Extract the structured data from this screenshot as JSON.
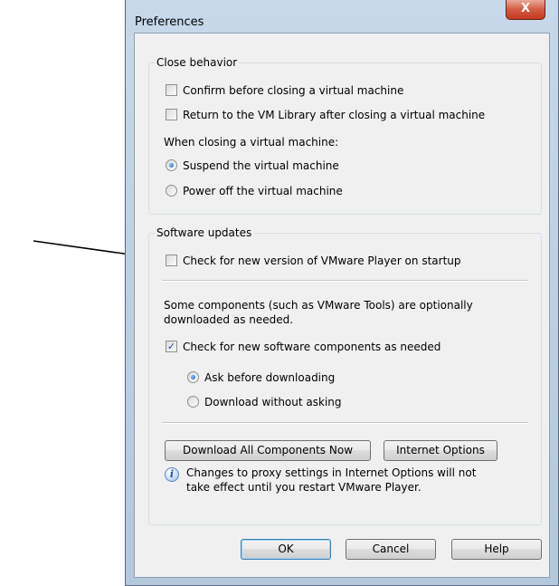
{
  "window": {
    "title": "Preferences",
    "close_glyph": "X"
  },
  "close_behavior": {
    "title": "Close behavior",
    "confirm_label": "Confirm before closing a virtual machine",
    "confirm_checked": false,
    "return_label": "Return to the VM Library after closing a virtual machine",
    "return_checked": false,
    "when_closing_label": "When closing a virtual machine:",
    "suspend_label": "Suspend the virtual machine",
    "power_off_label": "Power off the virtual machine",
    "selected_option": "suspend"
  },
  "software_updates": {
    "title": "Software updates",
    "check_new_version_label": "Check for new version of VMware Player on startup",
    "check_new_version_checked": false,
    "components_note_line1": "Some components (such as VMware Tools) are optionally",
    "components_note_line2": "downloaded as needed.",
    "check_components_label": "Check for new software components as needed",
    "check_components_checked": true,
    "ask_label": "Ask before downloading",
    "download_without_label": "Download without asking",
    "selected_download_option": "ask",
    "download_all_label": "Download All Components Now",
    "internet_options_label": "Internet Options",
    "info_line1": "Changes to proxy settings in Internet Options will not",
    "info_line2": "take effect until you restart VMware Player."
  },
  "buttons": {
    "ok_label": "OK",
    "cancel_label": "Cancel",
    "help_label": "Help"
  },
  "icons": {
    "checkmark": "✓",
    "info": "i",
    "close": "close-icon"
  }
}
